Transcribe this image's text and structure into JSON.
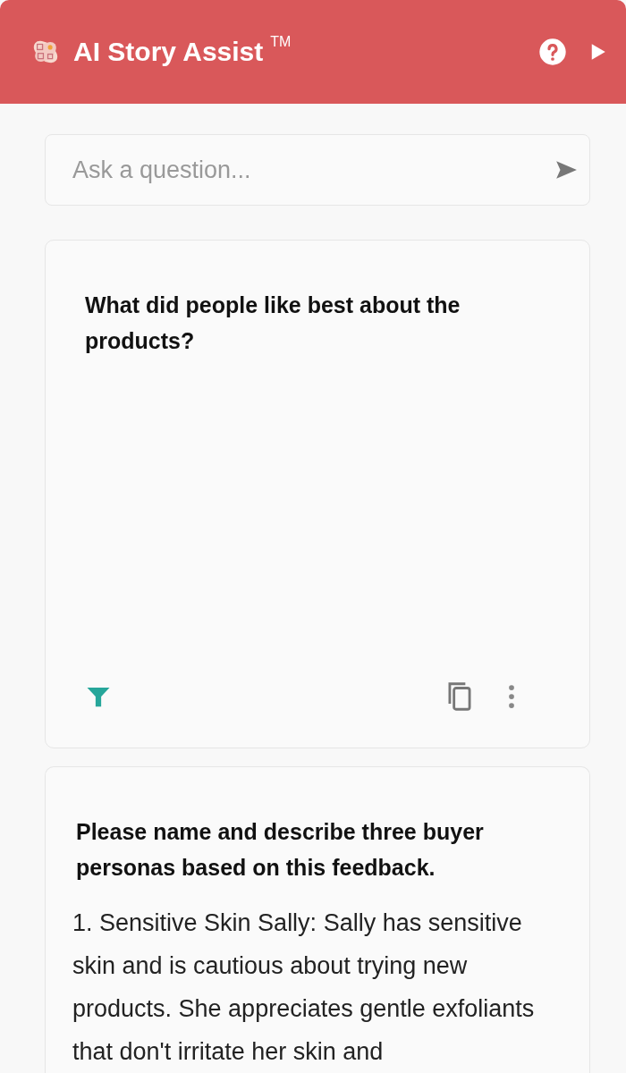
{
  "header": {
    "title": "AI Story Assist",
    "trademark": "TM"
  },
  "ask": {
    "placeholder": "Ask a question..."
  },
  "cards": [
    {
      "question": "What did people like best about the products?",
      "kind": "pending"
    },
    {
      "question": "Please name and describe three buyer personas based on this feedback.",
      "answer": " 1. Sensitive Skin Sally: Sally has sensitive skin and is cautious about trying new products. She appreciates gentle exfoliants that don't irritate her skin and",
      "kind": "answered"
    }
  ]
}
